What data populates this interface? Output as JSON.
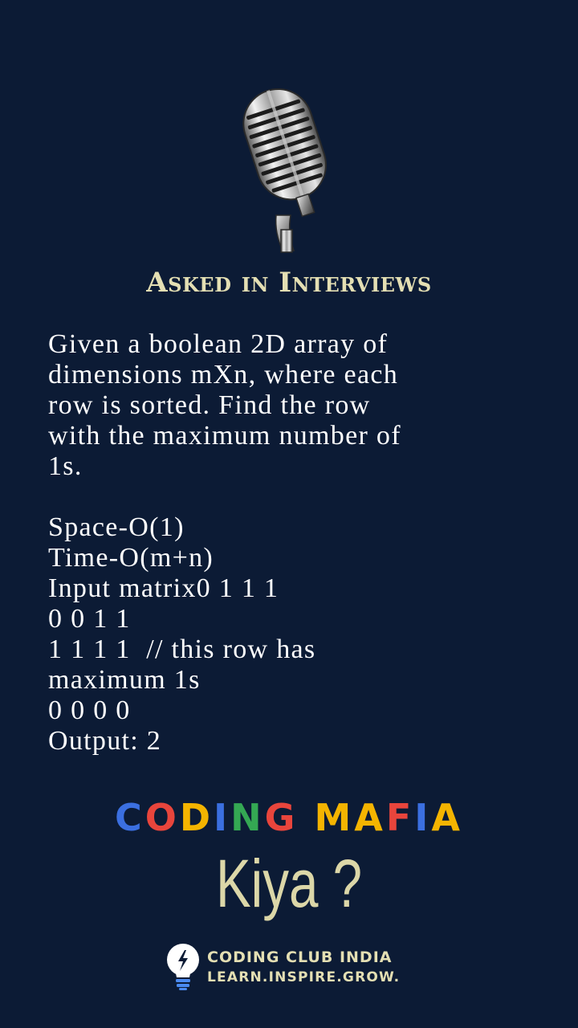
{
  "heading": "Asked in Interviews",
  "body_lines": [
    "Given a boolean 2D array of",
    "dimensions mXn, where each",
    "row is sorted. Find the row",
    "with the maximum number of",
    "1s.",
    "",
    "Space-O(1)",
    "Time-O(m+n)",
    "Input matrix0 1 1 1",
    "0 0 1 1",
    "1 1 1 1  // this row has",
    "maximum 1s",
    "0 0 0 0",
    "Output: 2"
  ],
  "brand": {
    "letters": [
      {
        "char": "C",
        "color": "#3b6fe0"
      },
      {
        "char": "O",
        "color": "#e8453c"
      },
      {
        "char": "D",
        "color": "#f4b400"
      },
      {
        "char": "I",
        "color": "#3b6fe0"
      },
      {
        "char": "N",
        "color": "#34a853"
      },
      {
        "char": "G",
        "color": "#e8453c"
      },
      {
        "char": " ",
        "color": "#ffffff"
      },
      {
        "char": "M",
        "color": "#f4b400"
      },
      {
        "char": "A",
        "color": "#f4b400"
      },
      {
        "char": "F",
        "color": "#e8453c"
      },
      {
        "char": "I",
        "color": "#3b6fe0"
      },
      {
        "char": "A",
        "color": "#f4b400"
      }
    ]
  },
  "tagline": "Kiya ?",
  "club": {
    "name": "CODING CLUB INDIA",
    "motto": "LEARN.INSPIRE.GROW."
  },
  "icons": {
    "hero": "microphone-icon",
    "logo": "lightbulb-icon"
  },
  "colors": {
    "background": "#0c1b35",
    "accent": "#e4dfb3"
  }
}
